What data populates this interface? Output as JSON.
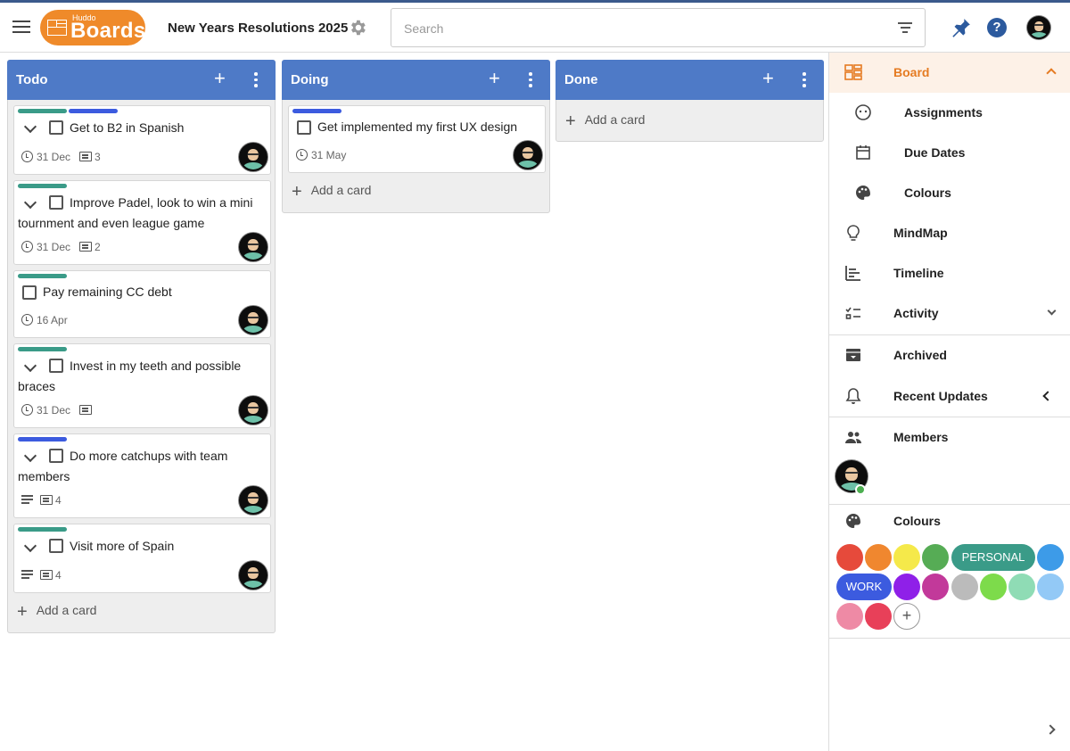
{
  "header": {
    "logo_small": "Huddo",
    "logo_big": "Boards",
    "board_title": "New Years Resolutions 2025",
    "search_placeholder": "Search"
  },
  "columns": [
    {
      "title": "Todo",
      "add_card": "Add a card",
      "cards": [
        {
          "title": "Get to B2 in Spanish",
          "date": "31 Dec",
          "comments": "3",
          "tags": [
            "#3a9b88",
            "#3c5bdf"
          ]
        },
        {
          "title": "Improve Padel, look to win a mini tournment and even league game",
          "date": "31 Dec",
          "comments": "2",
          "tags": [
            "#3a9b88"
          ]
        },
        {
          "title": "Pay remaining CC debt",
          "date": "16 Apr",
          "tags": [
            "#3a9b88"
          ]
        },
        {
          "title": "Invest in my teeth and possible braces",
          "date": "31 Dec",
          "tags": [
            "#3a9b88"
          ]
        },
        {
          "title": "Do more catchups with team members",
          "comments": "4",
          "tags": [
            "#3c5bdf"
          ]
        },
        {
          "title": "Visit more of Spain",
          "comments": "4",
          "tags": [
            "#3a9b88"
          ]
        }
      ]
    },
    {
      "title": "Doing",
      "add_card": "Add a card",
      "cards": [
        {
          "title": "Get implemented my first UX design",
          "date": "31 May",
          "tags": [
            "#3c5bdf"
          ]
        }
      ]
    },
    {
      "title": "Done",
      "add_card": "Add a card",
      "cards": []
    }
  ],
  "sidebar": {
    "board": "Board",
    "assignments": "Assignments",
    "due_dates": "Due Dates",
    "colours_sub": "Colours",
    "mindmap": "MindMap",
    "timeline": "Timeline",
    "activity": "Activity",
    "archived": "Archived",
    "recent_updates": "Recent Updates",
    "members": "Members",
    "colours": "Colours",
    "palette": {
      "personal_label": "PERSONAL",
      "work_label": "WORK",
      "row1": [
        "#e64a3b",
        "#f0872f",
        "#f5e94a",
        "#56ac55"
      ],
      "personal_color": "#3a9b88",
      "row1_end": "#3d9be8",
      "work_color": "#3c5bdf",
      "row2": [
        "#8f20e8",
        "#c2399a",
        "#bbbbbb",
        "#7ddb4b",
        "#8fdcb5",
        "#93c9f6"
      ],
      "row3": [
        "#ee8aa5",
        "#e84059"
      ]
    }
  }
}
